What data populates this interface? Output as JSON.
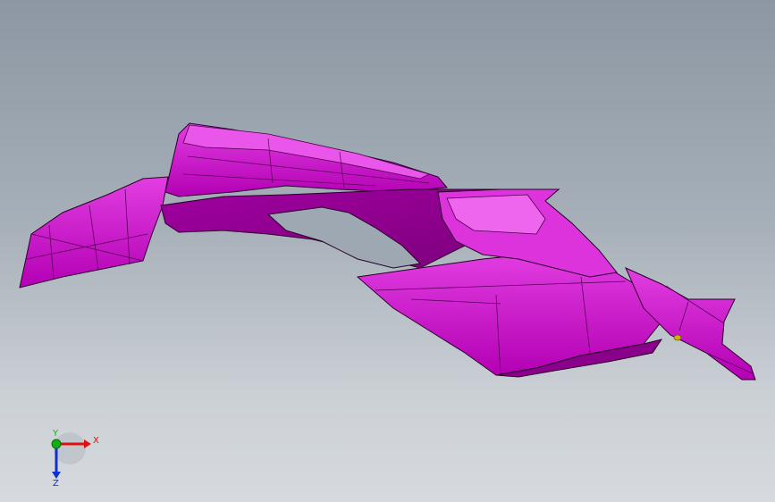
{
  "viewport": {
    "background_top": "#8c97a3",
    "background_bottom": "#d6dade"
  },
  "model": {
    "color": "#cc00cc",
    "highlight": "#e633e6",
    "shadow": "#990099",
    "edge_color": "#2a002a",
    "accent_color": "#c9b400"
  },
  "triad": {
    "x_label": "X",
    "y_label": "Y",
    "z_label": "Z",
    "x_color": "#e01010",
    "y_color": "#10b010",
    "z_color": "#1030d0"
  }
}
